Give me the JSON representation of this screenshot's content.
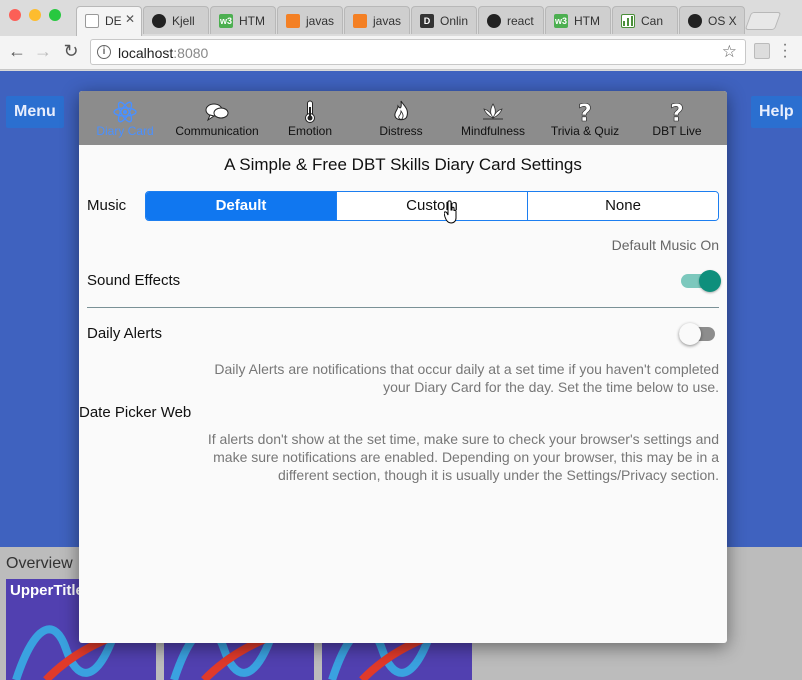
{
  "browser": {
    "tabs": [
      {
        "title": "DE",
        "favicon": "page-icon",
        "fav_color": "#ffffff"
      },
      {
        "title": "Kjell",
        "favicon": "github-icon",
        "fav_color": "#222222"
      },
      {
        "title": "HTM",
        "favicon": "w3schools-icon",
        "fav_color": "#4caf50"
      },
      {
        "title": "javas",
        "favicon": "stackoverflow-icon",
        "fav_color": "#f48024"
      },
      {
        "title": "javas",
        "favicon": "stackoverflow-icon",
        "fav_color": "#f48024"
      },
      {
        "title": "Onlin",
        "favicon": "d-icon",
        "fav_color": "#333333"
      },
      {
        "title": "react",
        "favicon": "github-icon",
        "fav_color": "#222222"
      },
      {
        "title": "HTM",
        "favicon": "w3schools-icon",
        "fav_color": "#4caf50"
      },
      {
        "title": "Can",
        "favicon": "chart-icon",
        "fav_color": "#4a8f3a"
      },
      {
        "title": "OS X",
        "favicon": "github-icon",
        "fav_color": "#222222"
      }
    ],
    "active_tab_close": "✕",
    "url_host": "localhost",
    "url_port": ":8080"
  },
  "page": {
    "menu_label": "Menu",
    "help_label": "Help",
    "overview_label": "Overview",
    "card_title": "UpperTitle"
  },
  "modal": {
    "nav": [
      {
        "label": "Diary Card",
        "icon": "atom-icon",
        "active": true
      },
      {
        "label": "Communication",
        "icon": "speech-bubbles-icon",
        "active": false
      },
      {
        "label": "Emotion",
        "icon": "thermometer-icon",
        "active": false
      },
      {
        "label": "Distress",
        "icon": "flame-icon",
        "active": false
      },
      {
        "label": "Mindfulness",
        "icon": "lotus-icon",
        "active": false
      },
      {
        "label": "Trivia & Quiz",
        "icon": "question-icon",
        "active": false
      },
      {
        "label": "DBT Live",
        "icon": "question-icon",
        "active": false
      }
    ],
    "title": "A Simple & Free DBT Skills Diary Card Settings",
    "music": {
      "label": "Music",
      "options": [
        "Default",
        "Custom",
        "None"
      ],
      "selected": "Default",
      "status": "Default Music On"
    },
    "sound_effects": {
      "label": "Sound Effects",
      "enabled": true
    },
    "daily_alerts": {
      "label": "Daily Alerts",
      "enabled": false,
      "description_line1": "Daily Alerts are notifications that occur daily at a set time if you haven't completed",
      "description_line2": "your Diary Card for the day. Set the time below to use."
    },
    "date_picker_label": "Date Picker Web",
    "browser_note_line1": "If alerts don't show at the set time, make sure to check your browser's settings and",
    "browser_note_line2": "make sure notifications are enabled. Depending on your browser, this may be in a",
    "browser_note_line3": "different section, though it is usually under the Settings/Privacy section."
  },
  "colors": {
    "accent": "#1077f0",
    "toggle_on": "#0e8f7c",
    "page_blue": "#3f62bf",
    "modal_nav": "#8c8c8c"
  }
}
